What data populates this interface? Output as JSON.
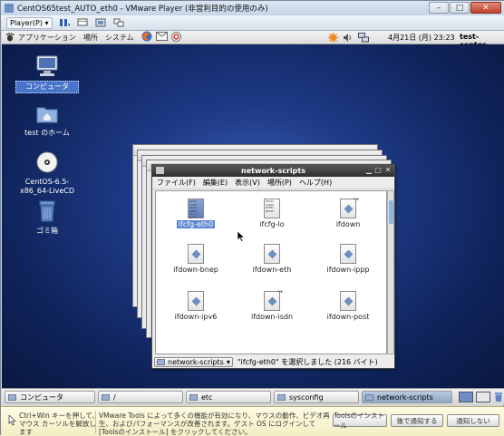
{
  "vm_window": {
    "title": "CentOS65test_AUTO_eth0 - VMware Player (非営利目的の使用のみ)",
    "minimize": "–",
    "maximize": "□",
    "close": "✕"
  },
  "vm_toolbar": {
    "player_menu": "Player(P) ▾"
  },
  "guest_panel": {
    "menus": [
      "アプリケーション",
      "場所",
      "システム"
    ],
    "datetime": "4月21日 (月)  23:23",
    "hostname": "test-centos"
  },
  "desktop_icons": [
    {
      "label": "コンピュータ",
      "icon": "computer-icon"
    },
    {
      "label": "test のホーム",
      "icon": "home-folder-icon"
    },
    {
      "label": "CentOS-6.5-x86_64-LiveCD",
      "icon": "disc-icon"
    },
    {
      "label": "ゴミ箱",
      "icon": "trash-icon"
    }
  ],
  "file_window": {
    "title": "network-scripts",
    "menu": [
      "ファイル(F)",
      "編集(E)",
      "表示(V)",
      "場所(P)",
      "ヘルプ(H)"
    ],
    "files": [
      {
        "name": "ifcfg-eth0",
        "selected": true,
        "preview": "DEVIC TYPE= UUID= ONBOO NM_CO BOOTP"
      },
      {
        "name": "ifcfg-lo",
        "selected": false,
        "preview": "DEVIC IPADD NETMA NETWO"
      },
      {
        "name": "ifdown",
        "selected": false,
        "link": true
      },
      {
        "name": "ifdown-bnep",
        "selected": false
      },
      {
        "name": "ifdown-eth",
        "selected": false
      },
      {
        "name": "ifdown-ippp",
        "selected": false
      },
      {
        "name": "ifdown-ipv6",
        "selected": false
      },
      {
        "name": "ifdown-isdn",
        "selected": false,
        "link": true
      },
      {
        "name": "ifdown-post",
        "selected": false
      }
    ],
    "location_select": "network-scripts",
    "status": "\"ifcfg-eth0\" を選択しました (216 バイト)"
  },
  "taskbar": [
    {
      "label": "コンピュータ",
      "active": false
    },
    {
      "label": "/",
      "active": false
    },
    {
      "label": "etc",
      "active": false
    },
    {
      "label": "sysconfig",
      "active": false
    },
    {
      "label": "network-scripts",
      "active": true
    }
  ],
  "notification": {
    "hint": "Ctrl+Win キーを押して、マウス カーソルを解放します",
    "message": "VMware Tools によって多くの機能が有効になり、マウスの動作、ビデオ再生、およびパフォーマンスが改善されます。ゲスト OS にログインして [Toolsのインストール] をクリックしてください。",
    "install_button": "Toolsのインストール",
    "later_button": "後で通知する",
    "never_button": "通知しない"
  }
}
